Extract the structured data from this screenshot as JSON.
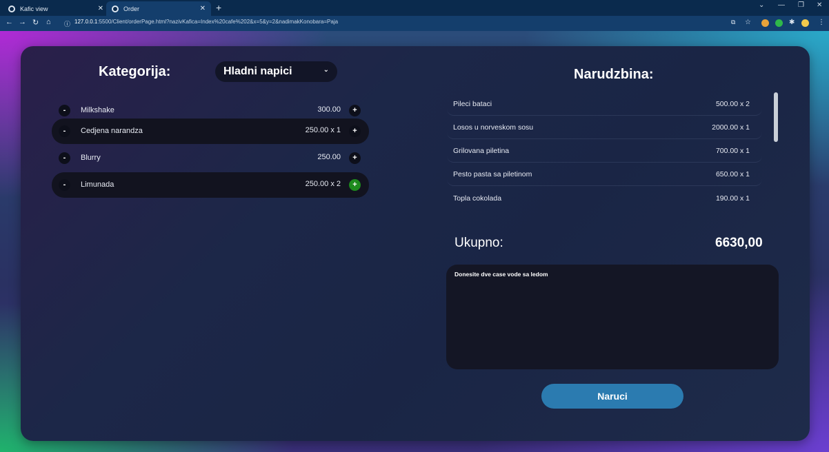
{
  "browser": {
    "tabs": [
      {
        "title": "Kafic view"
      },
      {
        "title": "Order"
      }
    ],
    "url_host": "127.0.0.1",
    "url_rest": ":5500/Client/orderPage.html?nazivKafica=Index%20cafe%202&x=5&y=2&nadimakKonobara=Paja"
  },
  "menu": {
    "category_label": "Kategorija:",
    "selected_category": "Hladni napici",
    "items": [
      {
        "name": "Milkshake",
        "price": "300.00",
        "highlighted": false,
        "plus_active": false
      },
      {
        "name": "Cedjena narandza",
        "price": "250.00 x 1",
        "highlighted": true,
        "plus_active": false
      },
      {
        "name": "Blurry",
        "price": "250.00",
        "highlighted": false,
        "plus_active": false
      },
      {
        "name": "Limunada",
        "price": "250.00 x 2",
        "highlighted": true,
        "plus_active": true
      }
    ],
    "minus_symbol": "-",
    "plus_symbol": "+"
  },
  "order": {
    "title": "Narudzbina:",
    "rows": [
      {
        "name": "Pileci bataci",
        "qty": "500.00 x 2"
      },
      {
        "name": "Losos u norveskom sosu",
        "qty": "2000.00 x 1"
      },
      {
        "name": "Grilovana piletina",
        "qty": "700.00 x 1"
      },
      {
        "name": "Pesto pasta sa piletinom",
        "qty": "650.00 x 1"
      },
      {
        "name": "Topla cokolada",
        "qty": "190.00 x 1"
      }
    ],
    "total_label": "Ukupno:",
    "total_value": "6630,00",
    "note": "Donesite dve case vode sa ledom",
    "submit_label": "Naruci"
  },
  "colors": {
    "accent_button": "#2b7bb0",
    "plus_active": "#1d8a1d"
  }
}
